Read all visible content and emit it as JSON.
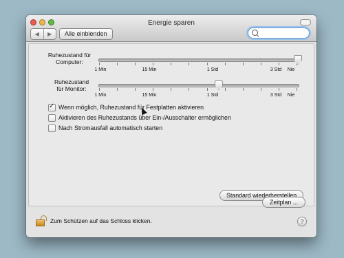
{
  "window": {
    "title": "Energie sparen"
  },
  "toolbar": {
    "back_glyph": "◀",
    "forward_glyph": "▶",
    "show_all_label": "Alle einblenden",
    "search_placeholder": "",
    "search_icon": "search-icon"
  },
  "sliders": {
    "computer": {
      "label_line1": "Ruhezustand für",
      "label_line2": "Computer:",
      "ticks": {
        "t1": "1 Min",
        "t2": "15 Min",
        "t3": "1 Std",
        "t4": "3 Std",
        "t5": "Nie"
      },
      "value": "Nie",
      "value_fraction": 1.0
    },
    "monitor": {
      "label_line1": "Ruhezustand",
      "label_line2": "für Monitor:",
      "ticks": {
        "t1": "1 Min",
        "t2": "15 Min",
        "t3": "1 Std",
        "t4": "3 Std",
        "t5": "Nie"
      },
      "value": "1 Std",
      "value_fraction": 0.6
    }
  },
  "options": {
    "disk_sleep": {
      "label": "Wenn möglich, Ruhezustand für Festplatten aktivieren",
      "checked": true
    },
    "power_button": {
      "label": "Aktivieren des Ruhezustands über Ein-/Ausschalter ermöglichen",
      "checked": false
    },
    "restart_after_power_failure": {
      "label": "Nach Stromausfall automatisch starten",
      "checked": false
    }
  },
  "buttons": {
    "restore_defaults": "Standard wiederherstellen",
    "schedule": "Zeitplan ..."
  },
  "footer": {
    "lock_text": "Zum Schützen auf das Schloss klicken.",
    "lock_icon": "lock-open-icon",
    "help_glyph": "?"
  }
}
